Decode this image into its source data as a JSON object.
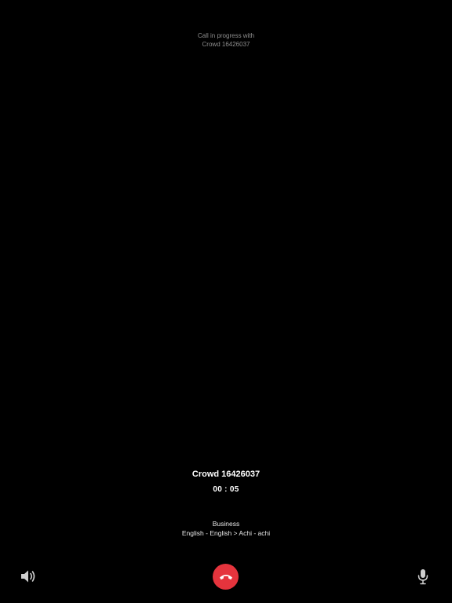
{
  "status": {
    "line1": "Call in progress with",
    "line2": "Crowd 16426037"
  },
  "caller": {
    "name": "Crowd 16426037",
    "timer": "00 : 05"
  },
  "details": {
    "category": "Business",
    "languages": "English - English > Achi - achi"
  },
  "controls": {
    "speaker_icon": "speaker-icon",
    "hangup_icon": "phone-hangup-icon",
    "mic_icon": "microphone-icon",
    "hangup_color": "#e5343d"
  }
}
